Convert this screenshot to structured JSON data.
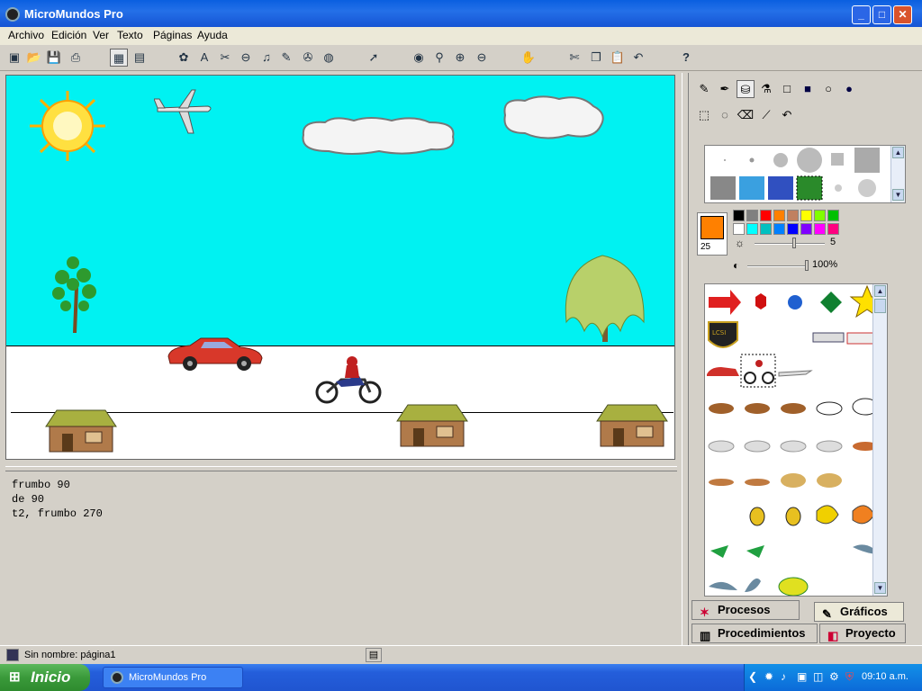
{
  "window": {
    "title": "MicroMundos Pro",
    "buttons": {
      "minimize": "_",
      "maximize": "□",
      "close": "✕"
    }
  },
  "menu": [
    "Archivo",
    "Edición",
    "Ver",
    "Texto",
    "Páginas",
    "Ayuda"
  ],
  "toolbar": {
    "icons": [
      "new-page-icon",
      "open-icon",
      "save-icon",
      "print-icon",
      "graphics-view-icon",
      "procedures-view-icon",
      "new-turtle-icon",
      "text-box-icon",
      "button-icon",
      "slider-icon",
      "music-icon",
      "record-sound-icon",
      "video-icon",
      "link-icon",
      "pointer-icon",
      "eye-icon",
      "stamp-icon",
      "zoom-in-icon",
      "zoom-out-icon",
      "stop-icon",
      "cut-icon",
      "copy-icon",
      "paste-icon",
      "undo-icon",
      "help-icon"
    ],
    "help_label": "?"
  },
  "command_center": {
    "lines": [
      "frumbo 90",
      "de 90",
      "t2, frumbo 270"
    ]
  },
  "paint": {
    "brush_size": "25",
    "brightness_value": "5",
    "transparency_value": "100%",
    "current_color": "#ff8000",
    "palette_row1": [
      "#000000",
      "#808080",
      "#ff0000",
      "#ff8000",
      "#c08060",
      "#ffff00",
      "#80ff00",
      "#00c000"
    ],
    "palette_row2": [
      "#ffffff",
      "#00ffff",
      "#00c0c0",
      "#0080ff",
      "#0000ff",
      "#8000ff",
      "#ff00ff",
      "#ff0080"
    ]
  },
  "tabs": {
    "procesos": "Procesos",
    "graficos": "Gráficos",
    "procedimientos": "Procedimientos",
    "proyecto": "Proyecto"
  },
  "status": {
    "text": "Sin nombre:  página1"
  },
  "taskbar": {
    "start": "Inicio",
    "app": "MicroMundos Pro",
    "clock": "09:10 a.m."
  }
}
